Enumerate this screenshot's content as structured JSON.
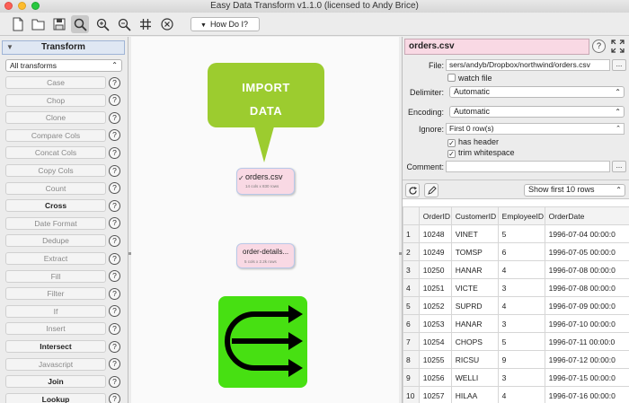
{
  "window": {
    "title": "Easy Data Transform v1.1.0 (licensed to Andy Brice)"
  },
  "toolbar": {
    "how_do_i_label": "How Do I?"
  },
  "left_panel": {
    "header": "Transform",
    "filter_value": "All transforms",
    "help_glyph": "?",
    "items": [
      {
        "label": "Case",
        "bold": false
      },
      {
        "label": "Chop",
        "bold": false
      },
      {
        "label": "Clone",
        "bold": false
      },
      {
        "label": "Compare Cols",
        "bold": false
      },
      {
        "label": "Concat Cols",
        "bold": false
      },
      {
        "label": "Copy Cols",
        "bold": false
      },
      {
        "label": "Count",
        "bold": false
      },
      {
        "label": "Cross",
        "bold": true
      },
      {
        "label": "Date Format",
        "bold": false
      },
      {
        "label": "Dedupe",
        "bold": false
      },
      {
        "label": "Extract",
        "bold": false
      },
      {
        "label": "Fill",
        "bold": false
      },
      {
        "label": "Filter",
        "bold": false
      },
      {
        "label": "If",
        "bold": false
      },
      {
        "label": "Insert",
        "bold": false
      },
      {
        "label": "Intersect",
        "bold": true
      },
      {
        "label": "Javascript",
        "bold": false
      },
      {
        "label": "Join",
        "bold": true
      },
      {
        "label": "Lookup",
        "bold": true
      }
    ]
  },
  "canvas": {
    "callout_line1": "IMPORT",
    "callout_line2": "DATA",
    "callout_color": "#9ccc2f",
    "node1": {
      "name": "orders.csv",
      "sub": "14 cols x 830 rows",
      "check": "✓"
    },
    "node2": {
      "name": "order-details...",
      "sub": "5 cols x 2.2k rows"
    },
    "node_color": "#f9d9e4",
    "branch_icon_color": "#47e012"
  },
  "right_panel": {
    "file_name": "orders.csv",
    "help_glyph": "?",
    "file_label": "File:",
    "file_value": "sers/andyb/Dropbox/northwind/orders.csv",
    "browse_label": "...",
    "watch_file_label": "watch file",
    "delimiter_label": "Delimiter:",
    "delimiter_value": "Automatic",
    "encoding_label": "Encoding:",
    "encoding_value": "Automatic",
    "ignore_label": "Ignore:",
    "ignore_value": "First 0 row(s)",
    "has_header_label": "has header",
    "trim_whitespace_label": "trim whitespace",
    "check_glyph": "✓",
    "comment_label": "Comment:",
    "comment_value": "",
    "show_rows_value": "Show first 10 rows"
  },
  "preview_table": {
    "columns": [
      "",
      "OrderID",
      "CustomerID",
      "EmployeeID",
      "OrderDate"
    ],
    "rows": [
      [
        "1",
        "10248",
        "VINET",
        "5",
        "1996-07-04 00:00:0"
      ],
      [
        "2",
        "10249",
        "TOMSP",
        "6",
        "1996-07-05 00:00:0"
      ],
      [
        "3",
        "10250",
        "HANAR",
        "4",
        "1996-07-08 00:00:0"
      ],
      [
        "4",
        "10251",
        "VICTE",
        "3",
        "1996-07-08 00:00:0"
      ],
      [
        "5",
        "10252",
        "SUPRD",
        "4",
        "1996-07-09 00:00:0"
      ],
      [
        "6",
        "10253",
        "HANAR",
        "3",
        "1996-07-10 00:00:0"
      ],
      [
        "7",
        "10254",
        "CHOPS",
        "5",
        "1996-07-11 00:00:0"
      ],
      [
        "8",
        "10255",
        "RICSU",
        "9",
        "1996-07-12 00:00:0"
      ],
      [
        "9",
        "10256",
        "WELLI",
        "3",
        "1996-07-15 00:00:0"
      ],
      [
        "10",
        "10257",
        "HILAA",
        "4",
        "1996-07-16 00:00:0"
      ]
    ]
  }
}
